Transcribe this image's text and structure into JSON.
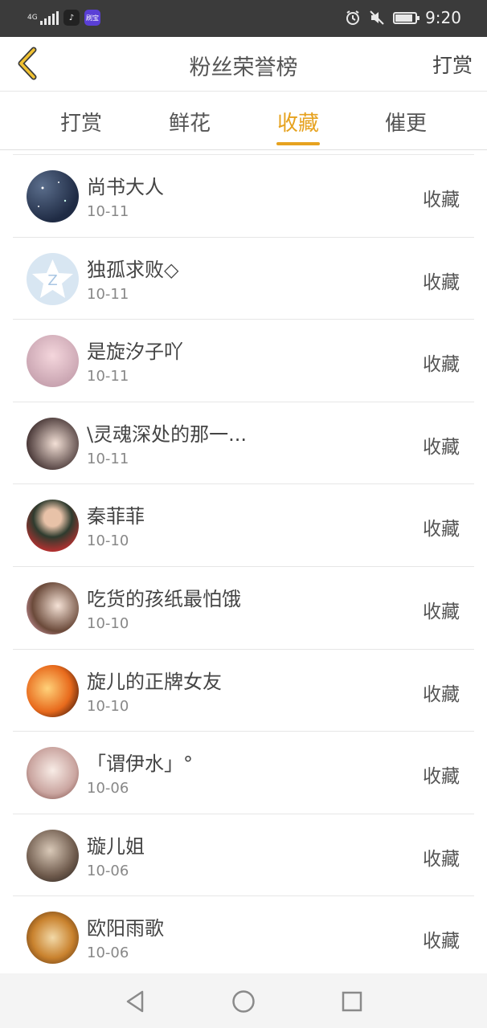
{
  "status_bar": {
    "network": "4G",
    "app_icons": [
      "tiktok-icon",
      "app-badge-icon"
    ],
    "app_badge_text": "刷宝",
    "time": "9:20"
  },
  "header": {
    "back_icon": "chevron-left-icon",
    "title": "粉丝荣誉榜",
    "action_label": "打赏"
  },
  "tabs": [
    {
      "label": "打赏",
      "active": false
    },
    {
      "label": "鲜花",
      "active": false
    },
    {
      "label": "收藏",
      "active": true
    },
    {
      "label": "催更",
      "active": false
    }
  ],
  "accent_color": "#e6a21f",
  "list": [
    {
      "name": "尚书大人",
      "date": "10-11",
      "action": "收藏"
    },
    {
      "name": "独孤求败◇",
      "date": "10-11",
      "action": "收藏"
    },
    {
      "name": "是旋汐子吖",
      "date": "10-11",
      "action": "收藏"
    },
    {
      "name": "\\灵魂深处的那一...",
      "date": "10-11",
      "action": "收藏"
    },
    {
      "name": "秦菲菲",
      "date": "10-10",
      "action": "收藏"
    },
    {
      "name": "吃货的孩纸最怕饿",
      "date": "10-10",
      "action": "收藏"
    },
    {
      "name": "旋儿的正牌女友",
      "date": "10-10",
      "action": "收藏"
    },
    {
      "name": "「谓伊水」°",
      "date": "10-06",
      "action": "收藏"
    },
    {
      "name": "璇儿姐",
      "date": "10-06",
      "action": "收藏"
    },
    {
      "name": "欧阳雨歌",
      "date": "10-06",
      "action": "收藏"
    }
  ],
  "nav_bar": {
    "buttons": [
      "back-triangle-icon",
      "home-circle-icon",
      "recents-square-icon"
    ]
  }
}
